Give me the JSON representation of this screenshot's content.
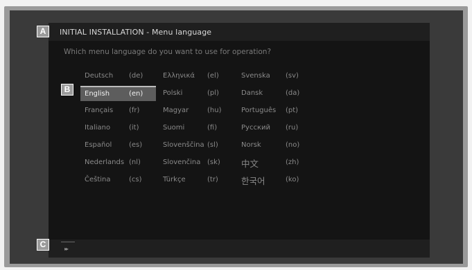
{
  "title": "INITIAL INSTALLATION - Menu language",
  "question": "Which menu language do you want to use for operation?",
  "badges": {
    "a": "A",
    "b": "B",
    "c": "C"
  },
  "bottom_icon": "fast-forward-icon",
  "bottom_glyph": "▸▸",
  "selected_language": "English",
  "languages": [
    [
      {
        "name": "Deutsch",
        "code": "(de)"
      },
      {
        "name": "English",
        "code": "(en)"
      },
      {
        "name": "Français",
        "code": "(fr)"
      },
      {
        "name": "Italiano",
        "code": "(it)"
      },
      {
        "name": "Español",
        "code": "(es)"
      },
      {
        "name": "Nederlands",
        "code": "(nl)"
      },
      {
        "name": "Čeština",
        "code": "(cs)"
      }
    ],
    [
      {
        "name": "Ελληνικά",
        "code": "(el)"
      },
      {
        "name": "Polski",
        "code": "(pl)"
      },
      {
        "name": "Magyar",
        "code": "(hu)"
      },
      {
        "name": "Suomi",
        "code": "(fi)"
      },
      {
        "name": "Slovenščina",
        "code": "(sl)"
      },
      {
        "name": "Slovenčina",
        "code": "(sk)"
      },
      {
        "name": "Türkçe",
        "code": "(tr)"
      }
    ],
    [
      {
        "name": "Svenska",
        "code": "(sv)"
      },
      {
        "name": "Dansk",
        "code": "(da)"
      },
      {
        "name": "Português",
        "code": "(pt)"
      },
      {
        "name": "Русский",
        "code": "(ru)"
      },
      {
        "name": "Norsk",
        "code": "(no)"
      },
      {
        "name": "中文",
        "code": "(zh)"
      },
      {
        "name": "한국어",
        "code": "(ko)"
      }
    ]
  ]
}
